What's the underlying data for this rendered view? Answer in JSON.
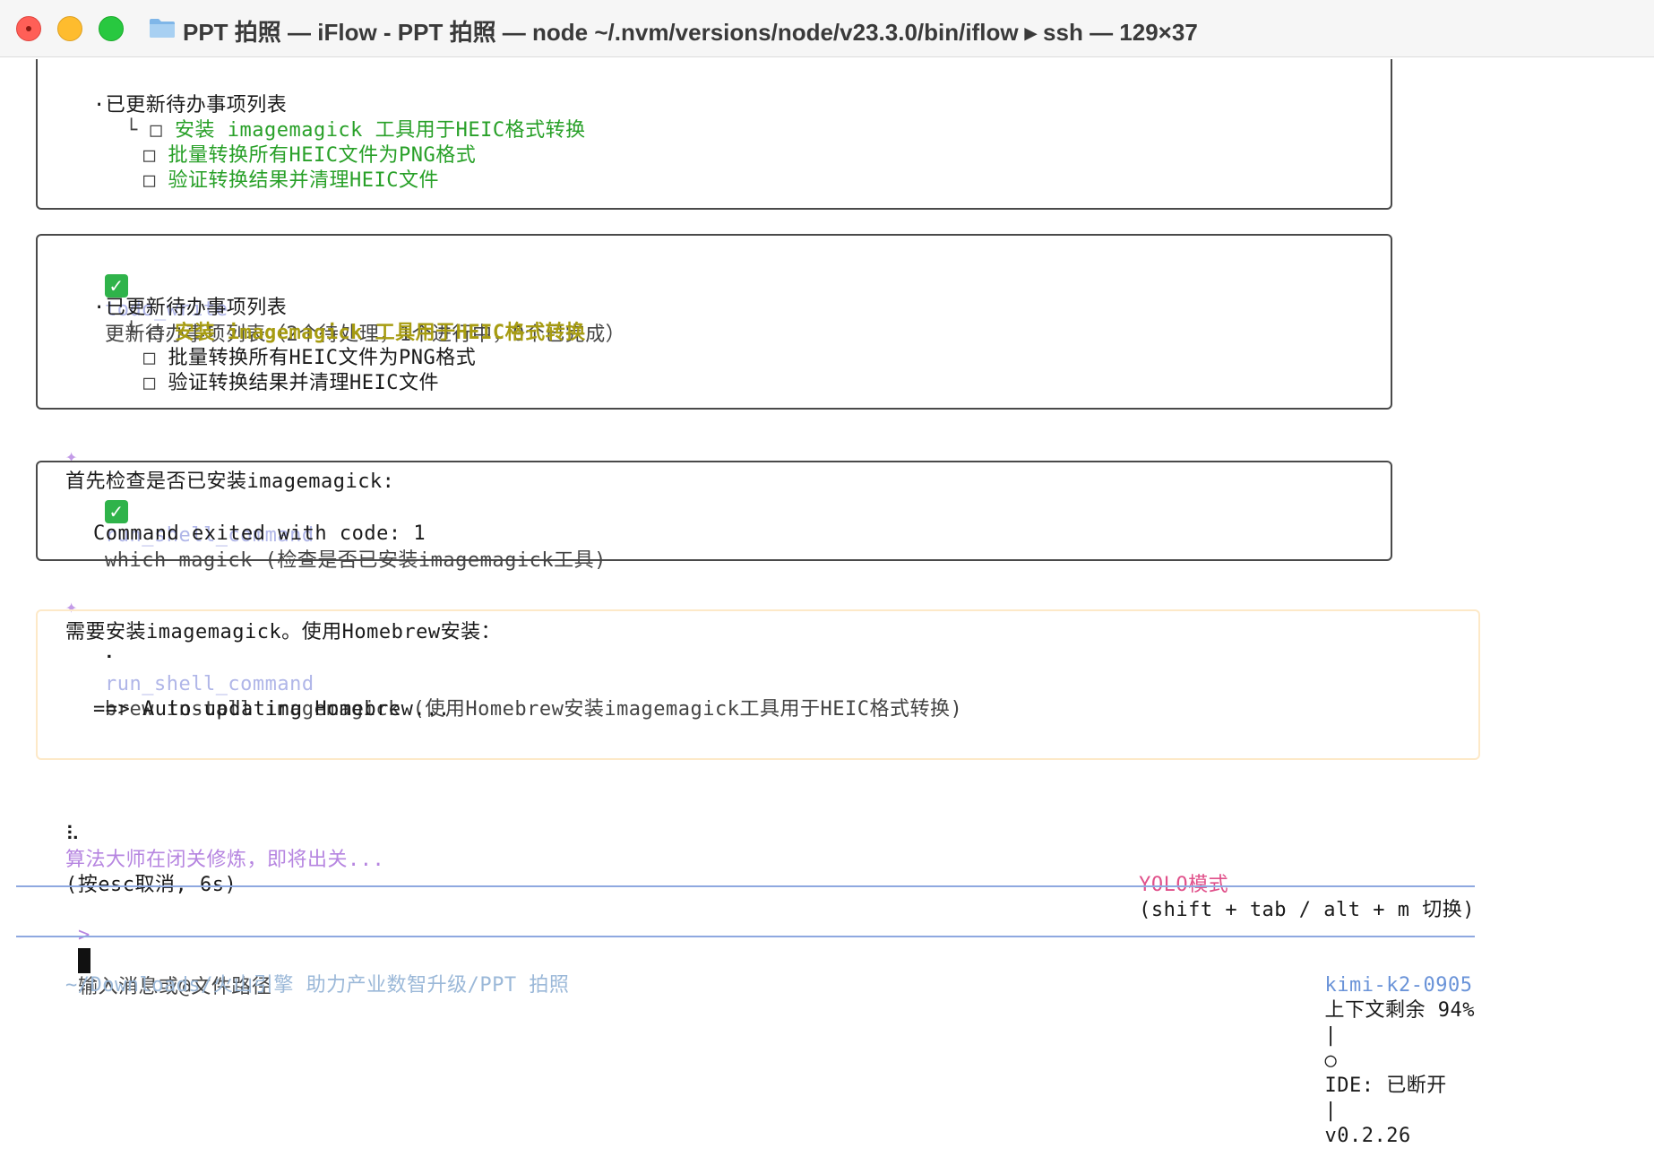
{
  "window": {
    "title": "PPT 拍照 — iFlow - PPT 拍照 — node ~/.nvm/versions/node/v23.3.0/bin/iflow ▸ ssh — 129×37"
  },
  "block1": {
    "heading": "·已更新待办事项列表",
    "items": [
      "安装 imagemagick 工具用于HEIC格式转换",
      "批量转换所有HEIC文件为PNG格式",
      "验证转换结果并清理HEIC文件"
    ]
  },
  "block2": {
    "tool": "todo_write",
    "desc": "更新待办事项列表（2个待处理，1个进行中，0个已完成）",
    "heading": "·已更新待办事项列表",
    "items": [
      "安装 imagemagick 工具用于HEIC格式转换",
      "批量转换所有HEIC文件为PNG格式",
      "验证转换结果并清理HEIC文件"
    ]
  },
  "msg1": "首先检查是否已安装imagemagick:",
  "block3": {
    "tool": "run_shell_command",
    "desc": "which magick (检查是否已安装imagemagick工具)",
    "output": "Command exited with code: 1"
  },
  "msg2": "需要安装imagemagick。使用Homebrew安装：",
  "block4": {
    "tool": "run_shell_command",
    "desc": "brew install imagemagick (使用Homebrew安装imagemagick工具用于HEIC格式转换)",
    "output": "==> Auto-updating Homebrew..."
  },
  "thinking": {
    "text": "算法大师在闭关修炼，即将出关...",
    "hint": "(按esc取消, 6s)"
  },
  "mode": {
    "label": "YOLO模式",
    "hint": "(shift + tab / alt + m 切换)"
  },
  "input": {
    "prompt": ">",
    "placeholder": "输入消息或@文件路径"
  },
  "status": {
    "path": "~/Downloads/火山引擎 助力产业数智升级/PPT 拍照",
    "model": "kimi-k2-0905",
    "context": "上下文剩余 94%",
    "sep1": "|",
    "ide_icon": "○",
    "ide": "IDE: 已断开",
    "sep2": "|",
    "version": "v0.2.26"
  },
  "colors": {
    "accent_blue": "#6a93d8",
    "success_green": "#28a028",
    "yolo_pink": "#e0508a",
    "thinking_purple": "#b685e0"
  }
}
